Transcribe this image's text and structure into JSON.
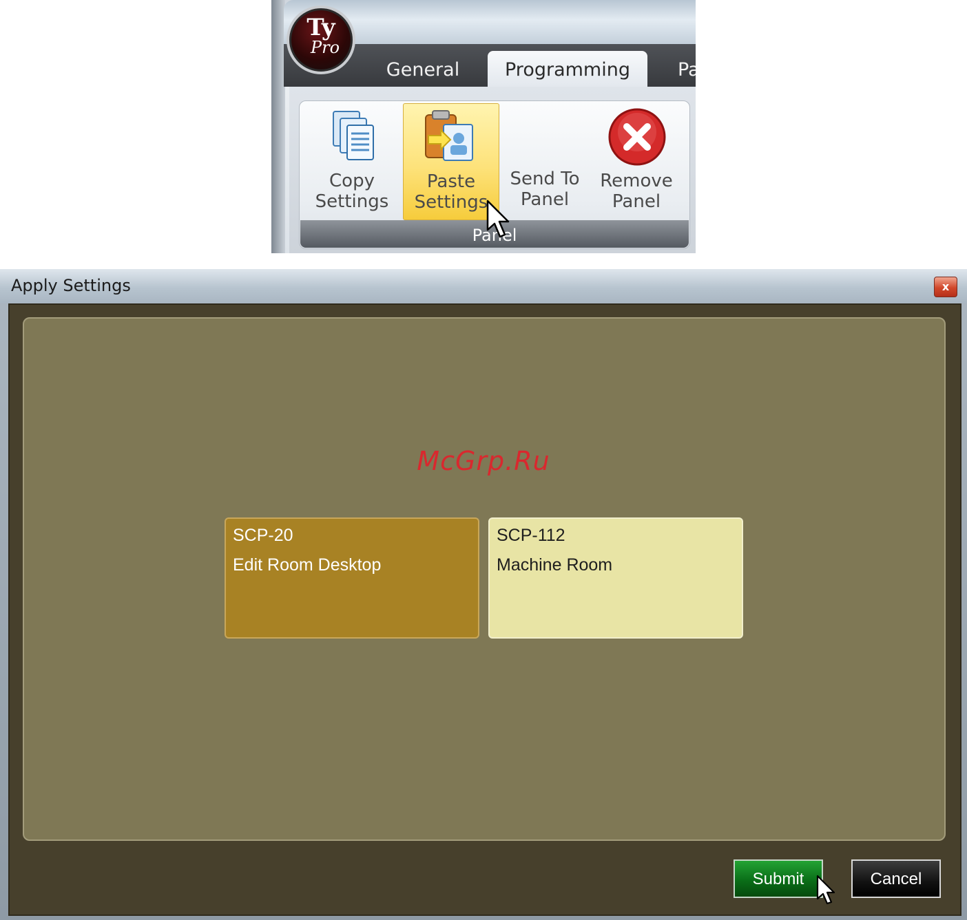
{
  "ribbon": {
    "logo": {
      "line1": "Ty",
      "line2": "Pro"
    },
    "tabs": [
      {
        "label": "General",
        "active": false
      },
      {
        "label": "Programming",
        "active": true
      },
      {
        "label": "Pa",
        "active": false
      }
    ],
    "group_label": "Panel",
    "buttons": [
      {
        "line1": "Copy",
        "line2": "Settings",
        "icon": "copy-icon",
        "hovered": false
      },
      {
        "line1": "Paste",
        "line2": "Settings",
        "icon": "paste-icon",
        "hovered": true
      },
      {
        "line1": "Send To",
        "line2": "Panel",
        "icon": "none",
        "hovered": false
      },
      {
        "line1": "Remove",
        "line2": "Panel",
        "icon": "remove-icon",
        "hovered": false
      }
    ]
  },
  "dialog": {
    "title": "Apply Settings",
    "close_glyph": "x",
    "watermark": "McGrp.Ru",
    "panels": [
      {
        "id": "SCP-20",
        "name": "Edit Room Desktop",
        "selected": true
      },
      {
        "id": "SCP-112",
        "name": "Machine Room",
        "selected": false
      }
    ],
    "submit_label": "Submit",
    "cancel_label": "Cancel"
  },
  "colors": {
    "panel_selected": "#a88224",
    "panel_normal": "#e8e4a5",
    "content_bg": "#7f7855",
    "submit_green": "#0a6e18",
    "watermark_red": "#d9282e"
  }
}
